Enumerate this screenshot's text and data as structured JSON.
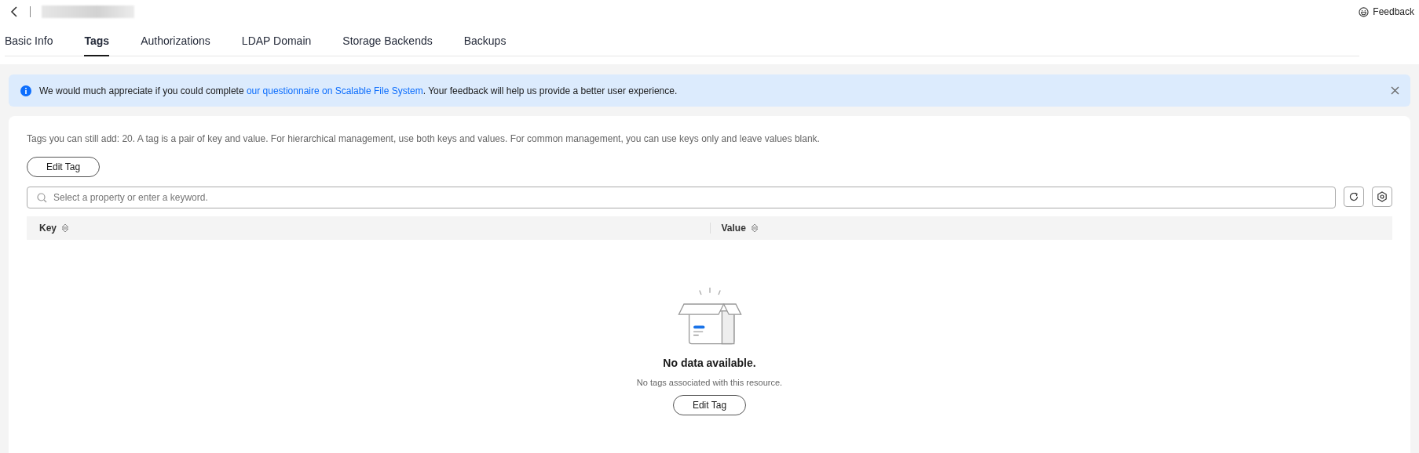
{
  "header": {
    "feedback": "Feedback"
  },
  "tabs": [
    {
      "label": "Basic Info",
      "selected": false
    },
    {
      "label": "Tags",
      "selected": true
    },
    {
      "label": "Authorizations",
      "selected": false
    },
    {
      "label": "LDAP Domain",
      "selected": false
    },
    {
      "label": "Storage Backends",
      "selected": false
    },
    {
      "label": "Backups",
      "selected": false
    }
  ],
  "notice": {
    "before": "We would much appreciate if you could complete ",
    "link": "our questionnaire on Scalable File System",
    "after": ". Your feedback will help us provide a better user experience."
  },
  "hint": "Tags you can still add: 20. A tag is a pair of key and value. For hierarchical management, use both keys and values. For common management, you can use keys only and leave values blank.",
  "edit_button": "Edit Tag",
  "search": {
    "placeholder": "Select a property or enter a keyword."
  },
  "table": {
    "columns": [
      "Key",
      "Value"
    ]
  },
  "empty_state": {
    "title": "No data available.",
    "message": "No tags associated with this resource.",
    "button": "Edit Tag"
  }
}
